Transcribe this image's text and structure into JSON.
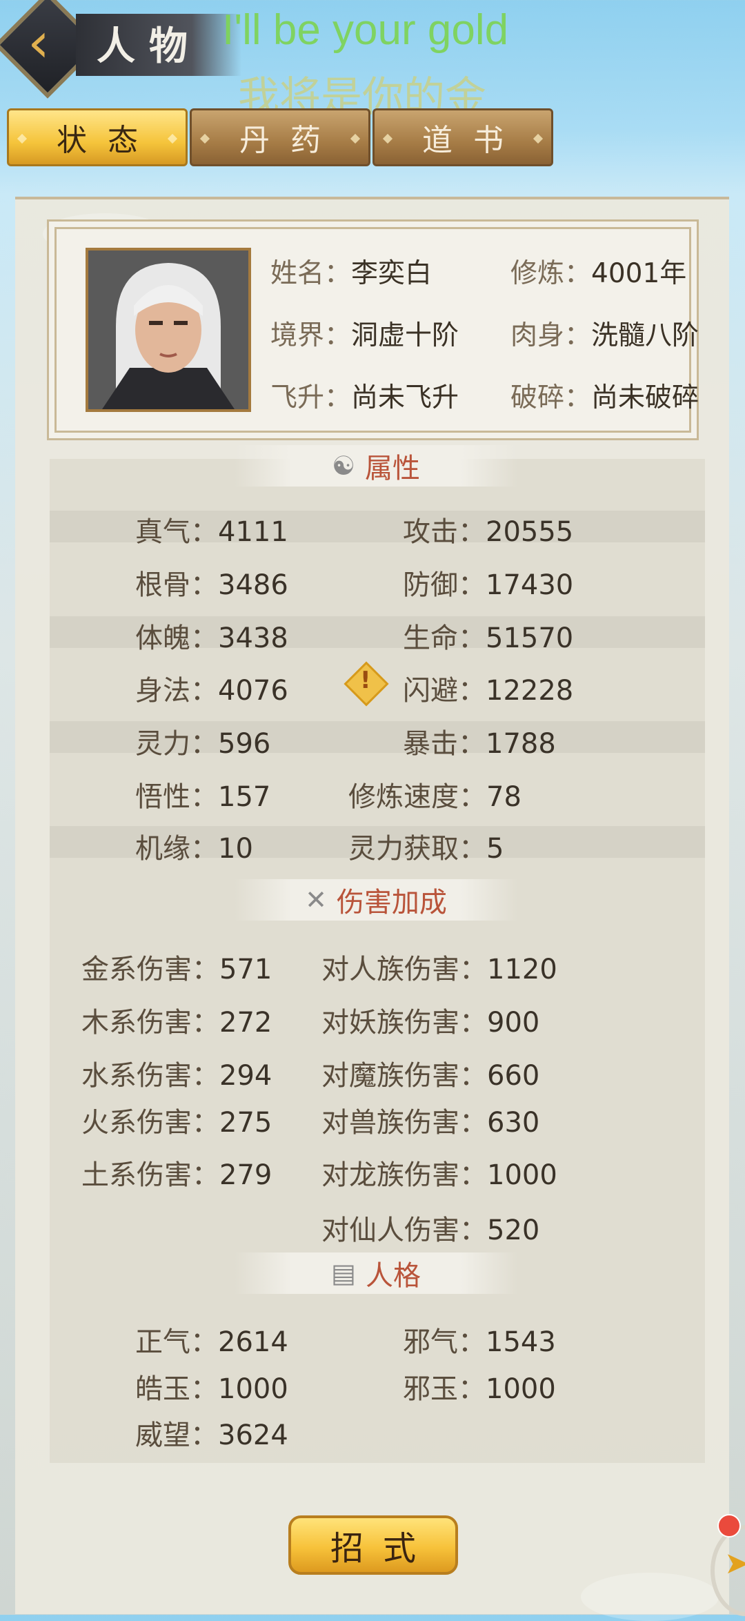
{
  "header": {
    "title": "人物",
    "overlay_en": "I'll be your gold",
    "overlay_zh": "我将是你的金"
  },
  "tabs": [
    {
      "label": "状态",
      "active": true
    },
    {
      "label": "丹药",
      "active": false
    },
    {
      "label": "道书",
      "active": false
    }
  ],
  "profile": {
    "name_label": "姓名：",
    "name_value": "李奕白",
    "cultivation_label": "修炼：",
    "cultivation_value": "4001年",
    "realm_label": "境界：",
    "realm_value": "洞虚十阶",
    "body_label": "肉身：",
    "body_value": "洗髓八阶",
    "ascend_label": "飞升：",
    "ascend_value": "尚未飞升",
    "shatter_label": "破碎：",
    "shatter_value": "尚未破碎"
  },
  "sections": {
    "attributes": "属性",
    "damage_bonus": "伤害加成",
    "personality": "人格"
  },
  "attributes": [
    {
      "label": "真气：",
      "value": "4111"
    },
    {
      "label": "攻击：",
      "value": "20555"
    },
    {
      "label": "根骨：",
      "value": "3486"
    },
    {
      "label": "防御：",
      "value": "17430"
    },
    {
      "label": "体魄：",
      "value": "3438"
    },
    {
      "label": "生命：",
      "value": "51570"
    },
    {
      "label": "身法：",
      "value": "4076"
    },
    {
      "label": "闪避：",
      "value": "12228"
    },
    {
      "label": "灵力：",
      "value": "596"
    },
    {
      "label": "暴击：",
      "value": "1788"
    },
    {
      "label": "悟性：",
      "value": "157"
    },
    {
      "label": "修炼速度：",
      "value": "78"
    },
    {
      "label": "机缘：",
      "value": "10"
    },
    {
      "label": "灵力获取：",
      "value": "5"
    }
  ],
  "damage": [
    {
      "label": "金系伤害：",
      "value": "571"
    },
    {
      "label": "对人族伤害：",
      "value": "1120"
    },
    {
      "label": "木系伤害：",
      "value": "272"
    },
    {
      "label": "对妖族伤害：",
      "value": "900"
    },
    {
      "label": "水系伤害：",
      "value": "294"
    },
    {
      "label": "对魔族伤害：",
      "value": "660"
    },
    {
      "label": "火系伤害：",
      "value": "275"
    },
    {
      "label": "对兽族伤害：",
      "value": "630"
    },
    {
      "label": "土系伤害：",
      "value": "279"
    },
    {
      "label": "对龙族伤害：",
      "value": "1000"
    },
    {
      "label": "对仙人伤害：",
      "value": "520"
    }
  ],
  "personality": [
    {
      "label": "正气：",
      "value": "2614"
    },
    {
      "label": "邪气：",
      "value": "1543"
    },
    {
      "label": "皓玉：",
      "value": "1000"
    },
    {
      "label": "邪玉：",
      "value": "1000"
    },
    {
      "label": "威望：",
      "value": "3624"
    }
  ],
  "footer": {
    "skills_button": "招式"
  },
  "icons": {
    "back": "chevron-left-icon",
    "attributes": "yin-yang-icon",
    "damage": "crossed-swords-icon",
    "personality": "scroll-icon",
    "alert": "warning-icon"
  },
  "colors": {
    "accent_gold": "#f5c43b",
    "section_title": "#b9543a",
    "overlay_green": "#7ed35a"
  }
}
